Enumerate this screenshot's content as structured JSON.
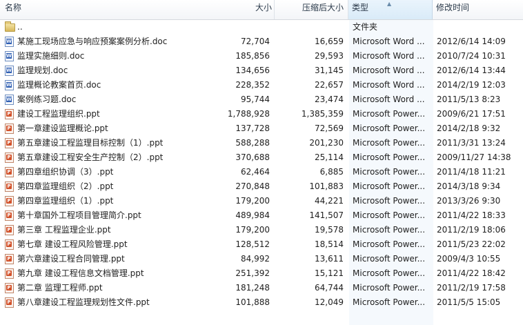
{
  "columns": {
    "name": "名称",
    "size": "大小",
    "compressed": "压缩后大小",
    "type": "类型",
    "modified": "修改时间"
  },
  "rows": [
    {
      "icon": "folder-icon",
      "kind": "folder",
      "name": "..",
      "size": "",
      "compressed": "",
      "type": "文件夹",
      "modified": ""
    },
    {
      "icon": "word-doc-icon",
      "kind": "doc",
      "name": "某施工现场应急与响应预案案例分析.doc",
      "size": "72,704",
      "compressed": "16,659",
      "type": "Microsoft Word ...",
      "modified": "2012/6/14 14:09"
    },
    {
      "icon": "word-doc-icon",
      "kind": "doc",
      "name": "监理实施细则.doc",
      "size": "185,856",
      "compressed": "29,593",
      "type": "Microsoft Word ...",
      "modified": "2010/7/24 10:31"
    },
    {
      "icon": "word-doc-icon",
      "kind": "doc",
      "name": "监理规划.doc",
      "size": "134,656",
      "compressed": "31,145",
      "type": "Microsoft Word ...",
      "modified": "2012/6/14 13:44"
    },
    {
      "icon": "word-doc-icon",
      "kind": "doc",
      "name": "监理概论教案首页.doc",
      "size": "228,352",
      "compressed": "22,657",
      "type": "Microsoft Word ...",
      "modified": "2014/2/19 12:03"
    },
    {
      "icon": "word-doc-icon",
      "kind": "doc",
      "name": "案例练习题.doc",
      "size": "95,744",
      "compressed": "23,474",
      "type": "Microsoft Word ...",
      "modified": "2011/5/13 8:23"
    },
    {
      "icon": "powerpoint-icon",
      "kind": "ppt",
      "name": "建设工程监理组织.ppt",
      "size": "1,788,928",
      "compressed": "1,385,359",
      "type": "Microsoft Power...",
      "modified": "2009/6/21 17:51"
    },
    {
      "icon": "powerpoint-icon",
      "kind": "ppt",
      "name": "第一章建设监理概论.ppt",
      "size": "137,728",
      "compressed": "72,569",
      "type": "Microsoft Power...",
      "modified": "2014/2/18 9:32"
    },
    {
      "icon": "powerpoint-icon",
      "kind": "ppt",
      "name": "第五章建设工程监理目标控制（1）.ppt",
      "size": "588,288",
      "compressed": "201,230",
      "type": "Microsoft Power...",
      "modified": "2011/3/31 13:24"
    },
    {
      "icon": "powerpoint-icon",
      "kind": "ppt",
      "name": "第五章建设工程安全生产控制（2）.ppt",
      "size": "370,688",
      "compressed": "25,114",
      "type": "Microsoft Power...",
      "modified": "2009/11/27 14:38"
    },
    {
      "icon": "powerpoint-icon",
      "kind": "ppt",
      "name": "第四章组织协调（3）.ppt",
      "size": "62,464",
      "compressed": "6,885",
      "type": "Microsoft Power...",
      "modified": "2011/4/18 11:21"
    },
    {
      "icon": "powerpoint-icon",
      "kind": "ppt",
      "name": "第四章监理组织（2）.ppt",
      "size": "270,848",
      "compressed": "101,883",
      "type": "Microsoft Power...",
      "modified": "2014/3/18 9:34"
    },
    {
      "icon": "powerpoint-icon",
      "kind": "ppt",
      "name": "第四章监理组织（1）.ppt",
      "size": "179,200",
      "compressed": "44,221",
      "type": "Microsoft Power...",
      "modified": "2013/3/26 9:30"
    },
    {
      "icon": "powerpoint-icon",
      "kind": "ppt",
      "name": "第十章国外工程项目管理简介.ppt",
      "size": "489,984",
      "compressed": "141,507",
      "type": "Microsoft Power...",
      "modified": "2011/4/22 18:33"
    },
    {
      "icon": "powerpoint-icon",
      "kind": "ppt",
      "name": "第三章 工程监理企业.ppt",
      "size": "179,200",
      "compressed": "19,578",
      "type": "Microsoft Power...",
      "modified": "2011/2/19 18:06"
    },
    {
      "icon": "powerpoint-icon",
      "kind": "ppt",
      "name": "第七章 建设工程风险管理.ppt",
      "size": "128,512",
      "compressed": "18,514",
      "type": "Microsoft Power...",
      "modified": "2011/5/23 22:02"
    },
    {
      "icon": "powerpoint-icon",
      "kind": "ppt",
      "name": "第六章建设工程合同管理.ppt",
      "size": "84,992",
      "compressed": "13,611",
      "type": "Microsoft Power...",
      "modified": "2009/4/3 10:55"
    },
    {
      "icon": "powerpoint-icon",
      "kind": "ppt",
      "name": "第九章 建设工程信息文档管理.ppt",
      "size": "251,392",
      "compressed": "15,121",
      "type": "Microsoft Power...",
      "modified": "2011/4/22 18:42"
    },
    {
      "icon": "powerpoint-icon",
      "kind": "ppt",
      "name": "第二章 监理工程师.ppt",
      "size": "181,248",
      "compressed": "64,744",
      "type": "Microsoft Power...",
      "modified": "2011/2/19 17:58"
    },
    {
      "icon": "powerpoint-icon",
      "kind": "ppt",
      "name": "第八章建设工程监理规划性文件.ppt",
      "size": "101,888",
      "compressed": "12,049",
      "type": "Microsoft Power...",
      "modified": "2011/5/5 15:05"
    }
  ]
}
